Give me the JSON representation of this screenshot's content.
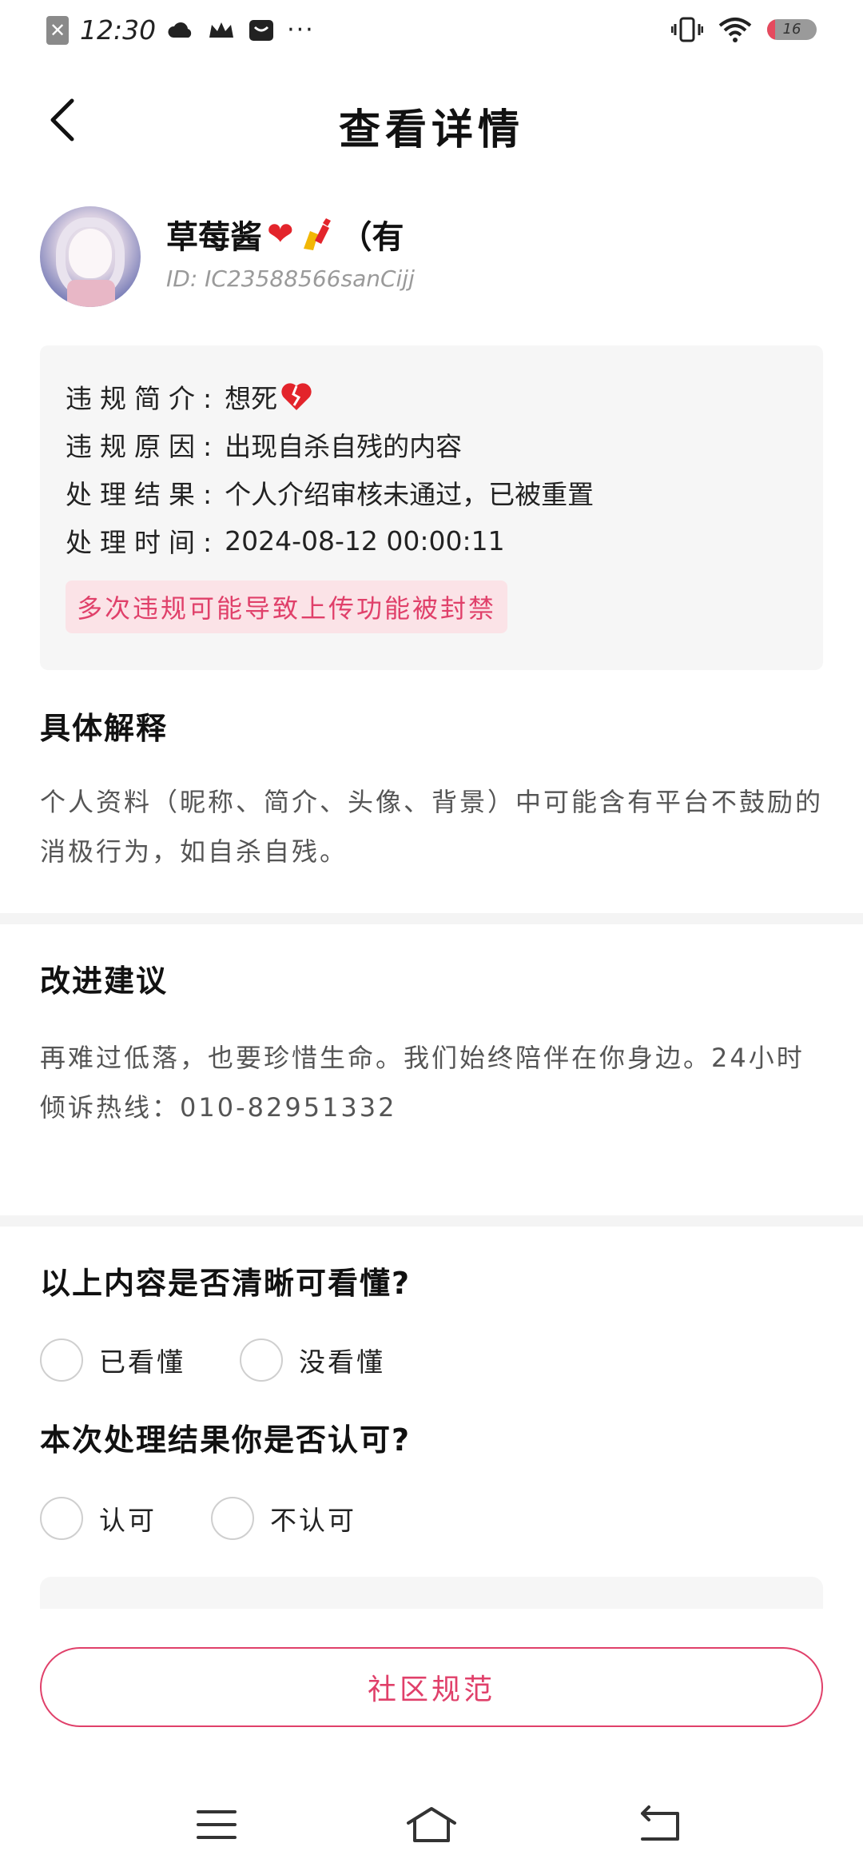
{
  "status_bar": {
    "time": "12:30",
    "battery_level": "16",
    "icons": [
      "close-notification-icon",
      "cloud-icon",
      "crown-icon",
      "message-icon",
      "more-icon",
      "vibrate-icon",
      "wifi-icon",
      "battery-icon"
    ],
    "more": "···"
  },
  "header": {
    "title": "查看详情",
    "back_icon": "chevron-left-icon"
  },
  "user": {
    "nickname": "草莓酱",
    "nickname_suffix": "（有",
    "id": "ID: IC23588566sanCijj"
  },
  "violation": {
    "summary_label": "违规简介:",
    "summary_value": "想死",
    "reason_label": "违规原因:",
    "reason_value": "出现自杀自残的内容",
    "result_label": "处理结果:",
    "result_value": "个人介绍审核未通过，已被重置",
    "time_label": "处理时间:",
    "time_value": "2024-08-12 00:00:11",
    "warning": "多次违规可能导致上传功能被封禁"
  },
  "explanation": {
    "title": "具体解释",
    "body": "个人资料（昵称、简介、头像、背景）中可能含有平台不鼓励的消极行为，如自杀自残。"
  },
  "suggestion": {
    "title": "改进建议",
    "body": "再难过低落，也要珍惜生命。我们始终陪伴在你身边。24小时倾诉热线：010-82951332"
  },
  "feedback": {
    "q1": "以上内容是否清晰可看懂?",
    "q1_options": [
      "已看懂",
      "没看懂"
    ],
    "q2": "本次处理结果你是否认可?",
    "q2_options": [
      "认可",
      "不认可"
    ]
  },
  "footer": {
    "rules_button": "社区规范"
  },
  "colors": {
    "accent": "#e0406a",
    "heart": "#e3242b",
    "card_bg": "#f6f6f6"
  }
}
